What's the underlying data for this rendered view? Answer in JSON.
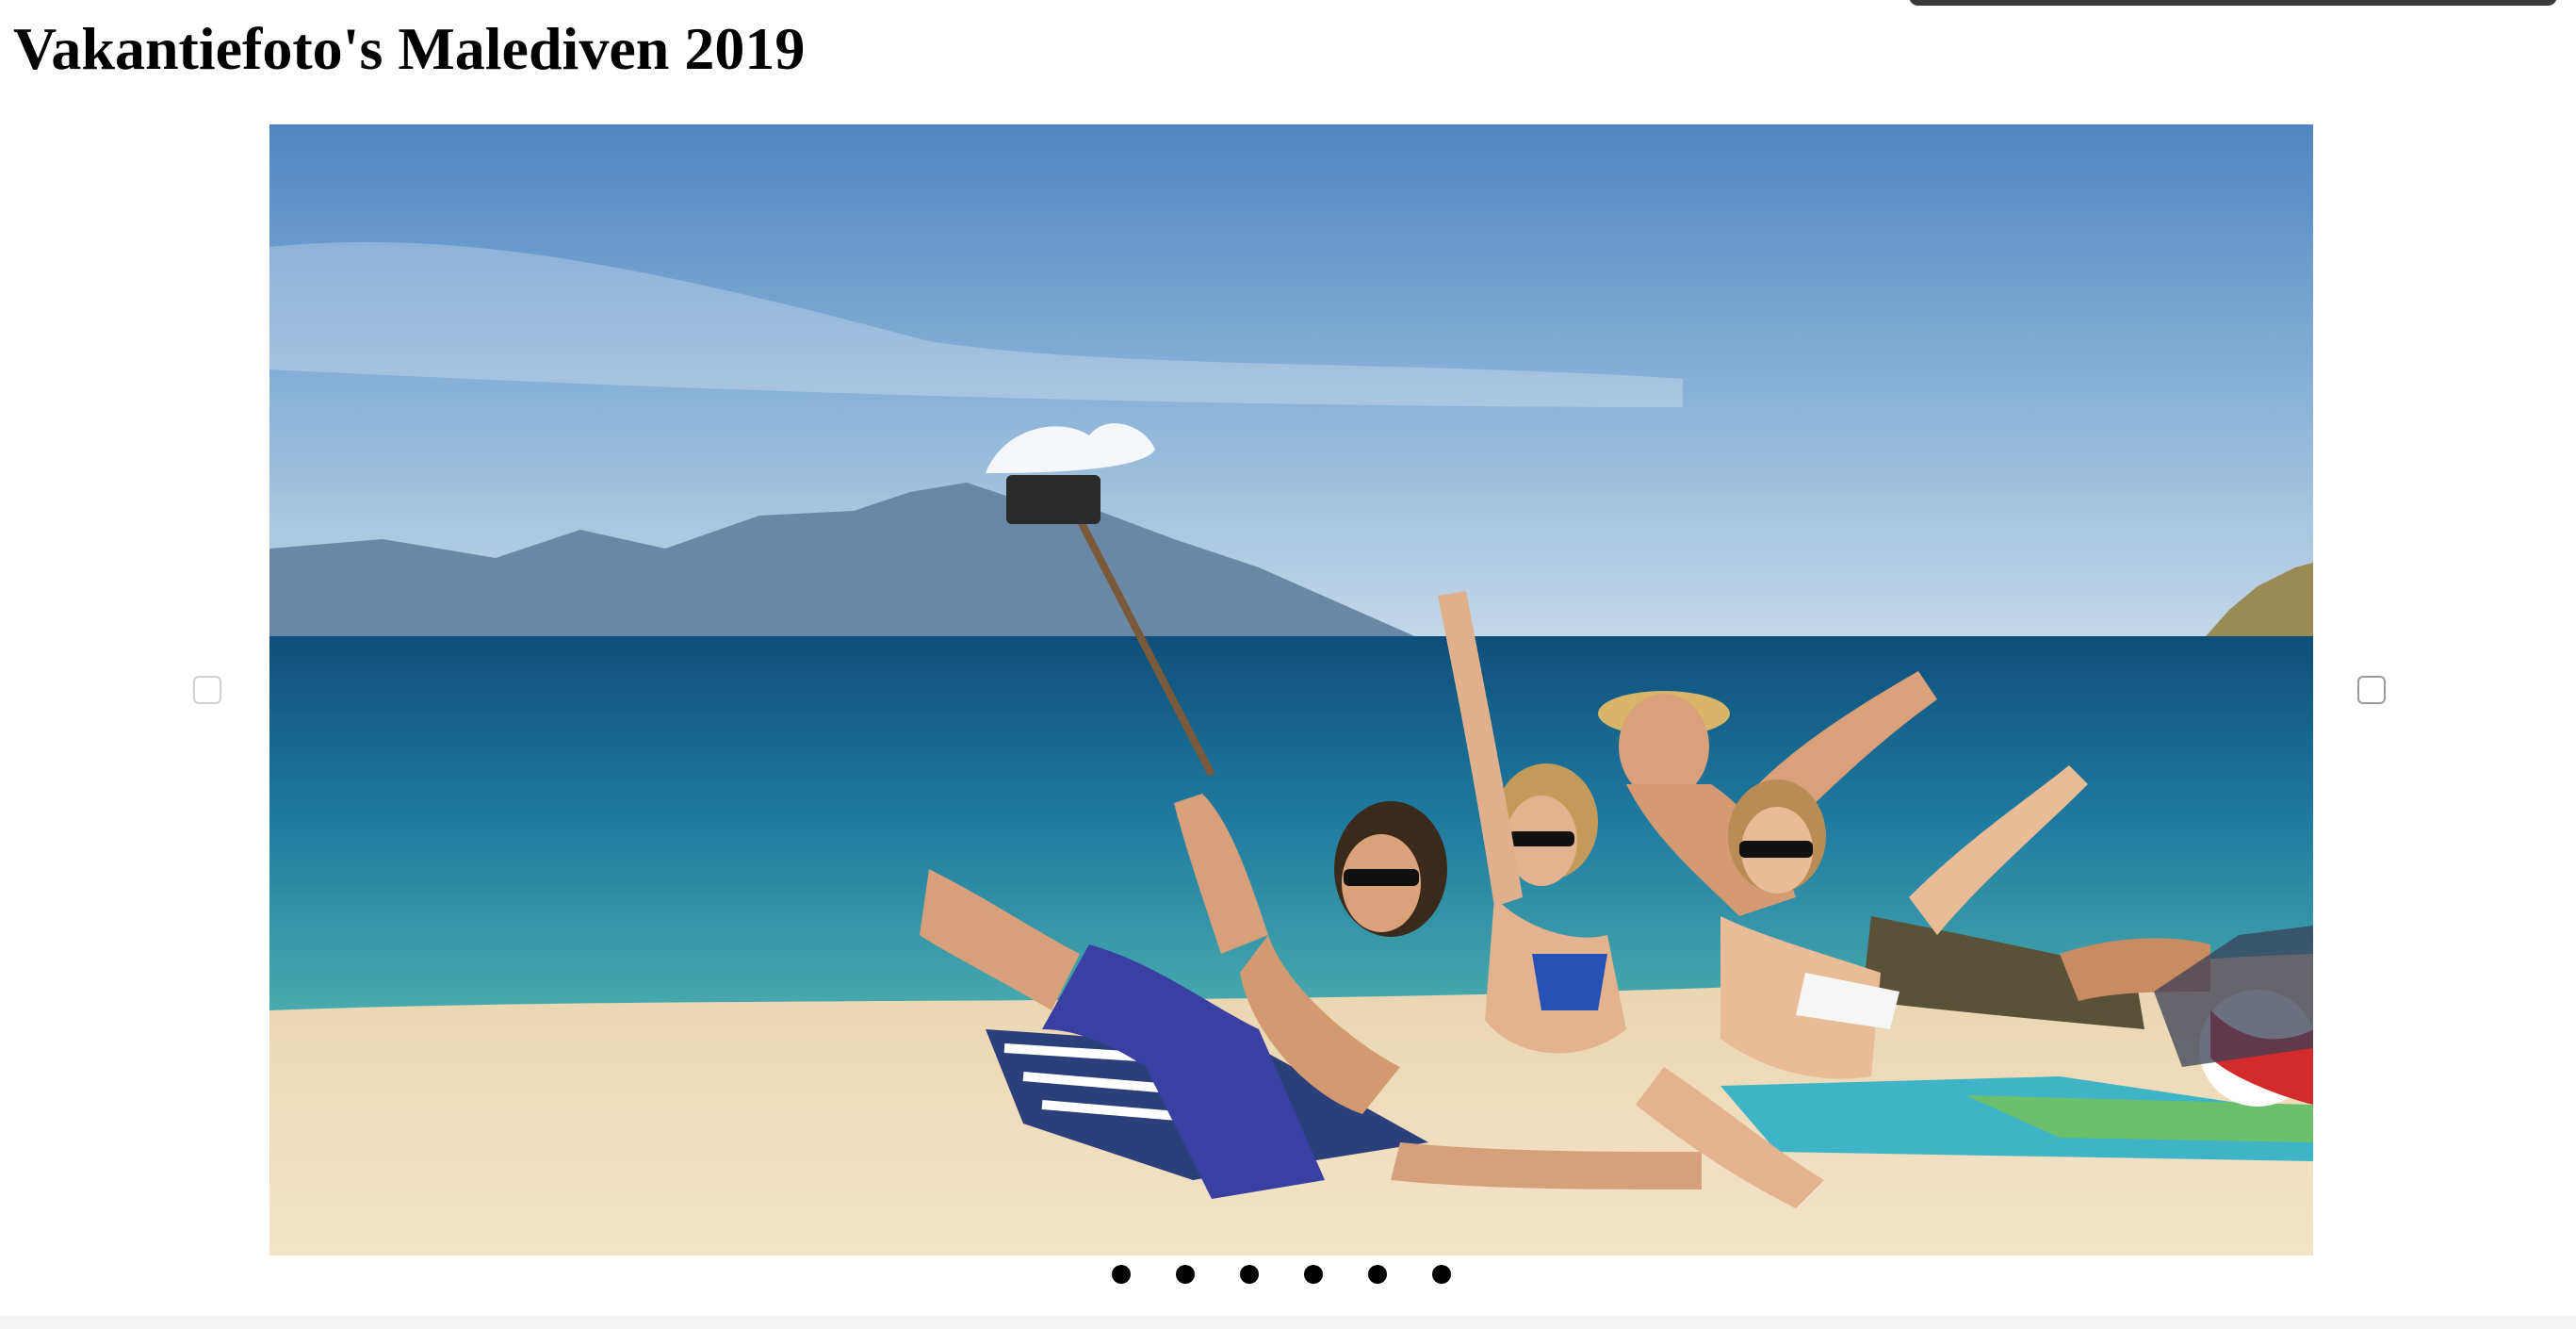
{
  "page": {
    "title": "Vakantiefoto's Malediven 2019"
  },
  "slideshow": {
    "current_slide": 1,
    "slide_count": 6,
    "current_image_icon": "beach-selfie-photo",
    "prev_icon": "prev-slide-icon",
    "next_icon": "next-slide-icon"
  },
  "colors": {
    "sky_top": "#4f86c2",
    "sea": "#1f7aa0",
    "sand": "#efdcbb",
    "dot": "#000000"
  }
}
